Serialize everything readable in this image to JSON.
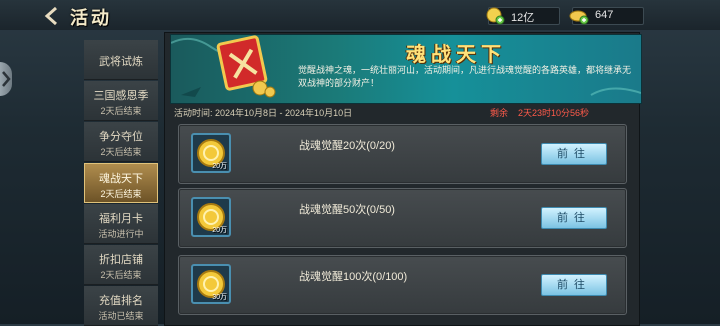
{
  "header": {
    "title": "活动"
  },
  "resources": [
    {
      "icon": "coin-stack-icon",
      "value": "12亿"
    },
    {
      "icon": "gold-ingot-icon",
      "value": "647"
    }
  ],
  "menu": [
    {
      "name": "武将试炼",
      "status": ""
    },
    {
      "name": "三国感恩季",
      "status": "2天后结束"
    },
    {
      "name": "争分夺位",
      "status": "2天后结束"
    },
    {
      "name": "魂战天下",
      "status": "2天后结束",
      "active": true
    },
    {
      "name": "福利月卡",
      "status": "活动进行中"
    },
    {
      "name": "折扣店铺",
      "status": "2天后结束"
    },
    {
      "name": "充值排名",
      "status": "活动已结束"
    }
  ],
  "banner": {
    "title": "魂战天下",
    "description": "觉醒战神之魂，一统壮丽河山，活动期间，凡进行战魂觉醒的各路英雄，都将继承无双战神的部分财产！"
  },
  "time": {
    "label": "活动时间: 2024年10月8日 - 2024年10月10日",
    "remain_label": "剩余",
    "remain_value": "2天23时10分56秒"
  },
  "tasks": [
    {
      "desc": "战魂觉醒20次(0/20)",
      "reward": "20万",
      "button": "前往"
    },
    {
      "desc": "战魂觉醒50次(0/50)",
      "reward": "20万",
      "button": "前往"
    },
    {
      "desc": "战魂觉醒100次(0/100)",
      "reward": "30万",
      "button": "前往"
    }
  ],
  "colors": {
    "accent": "#ffe27a",
    "timer": "#ff5a4a",
    "button": "#7cc3e3"
  }
}
